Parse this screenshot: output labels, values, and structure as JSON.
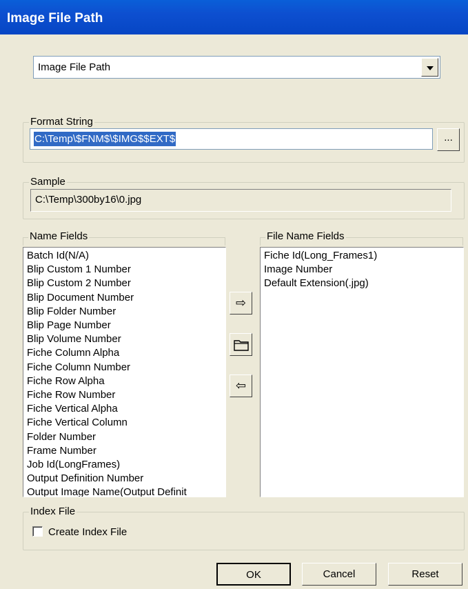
{
  "window": {
    "title": "Image File Path"
  },
  "combo": {
    "selected": "Image File Path"
  },
  "format_string": {
    "label": "Format String",
    "value": "C:\\Temp\\$FNM$\\$IMG$$EXT$",
    "browse_label": "..."
  },
  "sample": {
    "label": "Sample",
    "value": "C:\\Temp\\300by16\\0.jpg"
  },
  "name_fields": {
    "label": "Name Fields",
    "items": [
      "Batch Id(N/A)",
      "Blip Custom 1 Number",
      "Blip Custom 2 Number",
      "Blip Document Number",
      "Blip Folder Number",
      "Blip Page Number",
      "Blip Volume Number",
      "Fiche Column Alpha",
      "Fiche Column Number",
      "Fiche Row Alpha",
      "Fiche Row Number",
      "Fiche Vertical Alpha",
      "Fiche Vertical Column",
      "Folder Number",
      "Frame Number",
      "Job Id(LongFrames)",
      "Output Definition Number",
      "Output Image Name(Output Definit"
    ]
  },
  "file_name_fields": {
    "label": "File Name Fields",
    "items": [
      "Fiche Id(Long_Frames1)",
      "Image Number",
      "Default Extension(.jpg)"
    ]
  },
  "transfer_buttons": {
    "add_icon": "⇨",
    "folder_icon": "folder",
    "remove_icon": "⇦"
  },
  "index_file": {
    "label": "Index File",
    "checkbox_label": "Create Index File",
    "checked": false
  },
  "buttons": {
    "ok": "OK",
    "cancel": "Cancel",
    "reset": "Reset"
  }
}
